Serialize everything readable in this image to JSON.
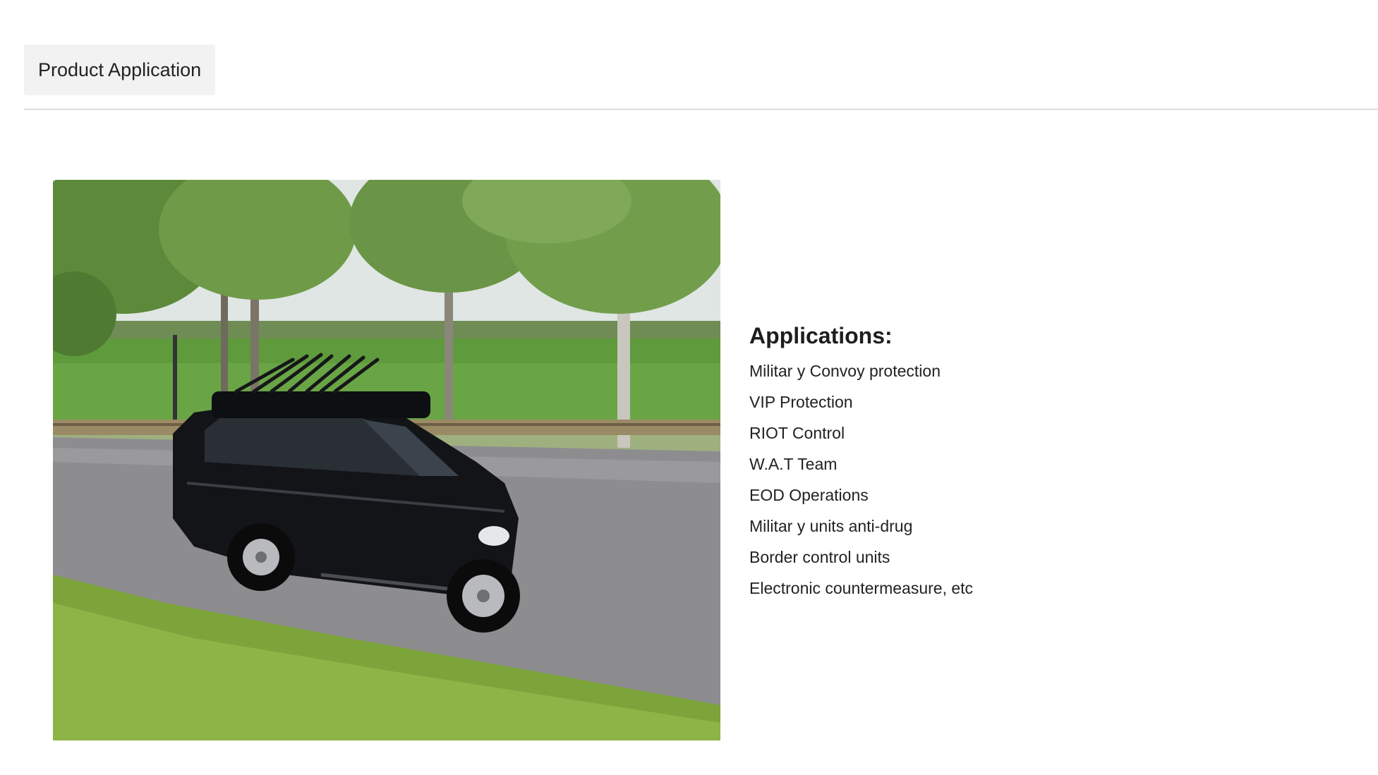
{
  "tabs": [
    {
      "label": "Product Application",
      "active": true
    }
  ],
  "photo": {
    "subject": "black SUV with roof-mounted jammer antennas driving on a road"
  },
  "applications": {
    "title": "Applications:",
    "items": [
      "Militar y Convoy protection",
      "VIP Protection",
      "RIOT Control",
      "W.A.T Team",
      "EOD Operations",
      "Militar y units anti-drug",
      "Border control units",
      "Electronic countermeasure, etc"
    ]
  },
  "colors": {
    "tab_background": "#f2f2f2",
    "divider": "#dddddd",
    "text": "#222222"
  }
}
